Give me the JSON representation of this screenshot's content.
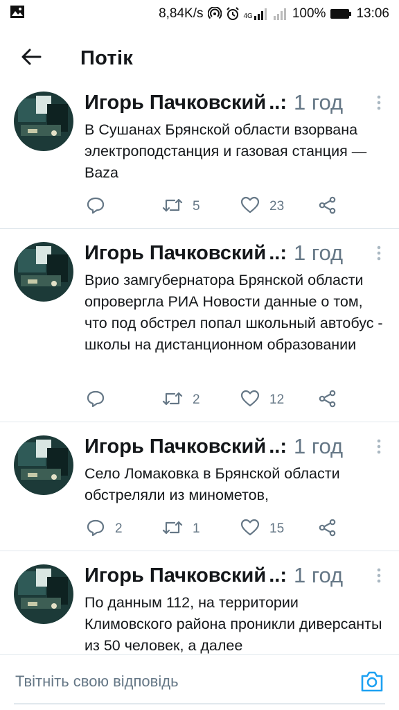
{
  "status_bar": {
    "network_speed": "8,84K/s",
    "network_type": "4G",
    "battery": "100%",
    "time": "13:06"
  },
  "header": {
    "title": "Потік",
    "back_icon": "arrow-left-icon"
  },
  "tweets": [
    {
      "author": "Игорь Пачковский",
      "ellipsis": "..:",
      "time": "1 год",
      "text": "В Сушанах Брянской области взорвана электроподстанция и газовая станция — Baza",
      "replies": "",
      "retweets": "5",
      "likes": "23"
    },
    {
      "author": "Игорь Пачковский",
      "ellipsis": "..:",
      "time": "1 год",
      "text": "Врио замгубернатора Брянской области опровергла РИА Новости данные о том, что под обстрел попал школьный автобус - школы на дистанционном образовании",
      "replies": "",
      "retweets": "2",
      "likes": "12"
    },
    {
      "author": "Игорь Пачковский",
      "ellipsis": "..:",
      "time": "1 год",
      "text": "Село Ломаковка в Брянской области обстреляли из минометов,",
      "replies": "2",
      "retweets": "1",
      "likes": "15"
    },
    {
      "author": "Игорь Пачковский",
      "ellipsis": "..:",
      "time": "1 год",
      "text": "По данным 112, на территории Климовского района проникли диверсанты из 50 человек, а далее",
      "replies": "",
      "retweets": "",
      "likes": ""
    }
  ],
  "reply_bar": {
    "placeholder": "Твітніть свою відповідь",
    "camera_icon": "camera-icon"
  },
  "colors": {
    "text_primary": "#14171a",
    "text_secondary": "#657786",
    "accent": "#1da1f2",
    "divider": "#e1e8ed"
  }
}
